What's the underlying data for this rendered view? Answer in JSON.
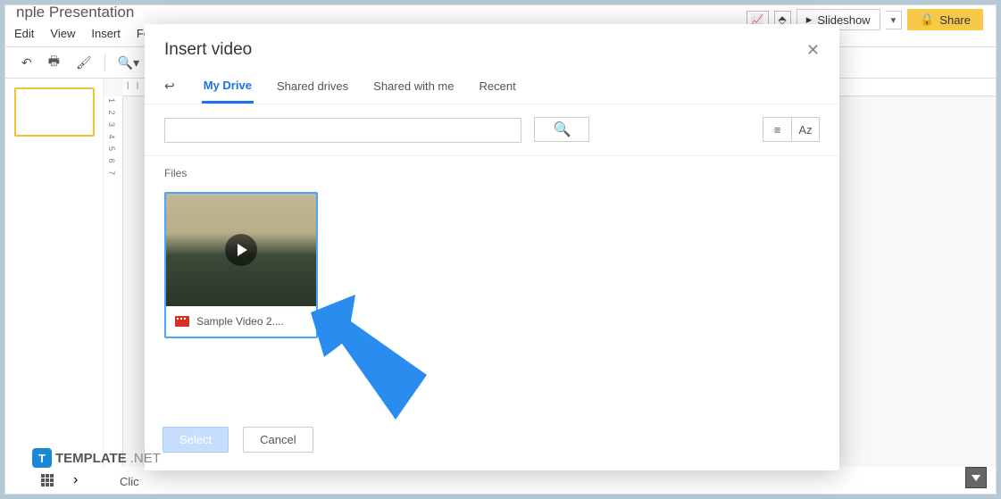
{
  "bg": {
    "title_partial": "nple Presentation",
    "menu": [
      "Edit",
      "View",
      "Insert",
      "Fo"
    ],
    "slideshow_label": "Slideshow",
    "share_label": "Share",
    "bottom_text": "Clic"
  },
  "modal": {
    "title": "Insert video",
    "tabs": {
      "my_drive": "My Drive",
      "shared_drives": "Shared drives",
      "shared_with_me": "Shared with me",
      "recent": "Recent"
    },
    "files_label": "Files",
    "file": {
      "name": "Sample Video 2...."
    },
    "buttons": {
      "select": "Select",
      "cancel": "Cancel"
    },
    "search_placeholder": ""
  },
  "watermark": {
    "brand": "TEMPLATE",
    "suffix": ".NET"
  }
}
